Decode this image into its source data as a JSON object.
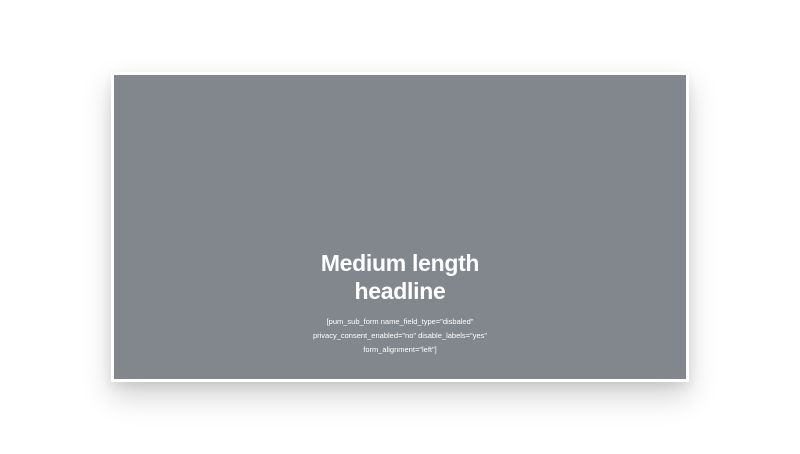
{
  "popup": {
    "headline_line1": "Medium length",
    "headline_line2": "headline",
    "shortcode_line1": "[pum_sub_form name_field_type=\"disbaled\"",
    "shortcode_line2": "privacy_consent_enabled=\"no\" disable_labels=\"yes\"",
    "shortcode_line3": "form_alignment=\"left\"]"
  },
  "colors": {
    "page_background": "#ffffff",
    "panel_background": "#82868d",
    "text": "#ffffff"
  }
}
